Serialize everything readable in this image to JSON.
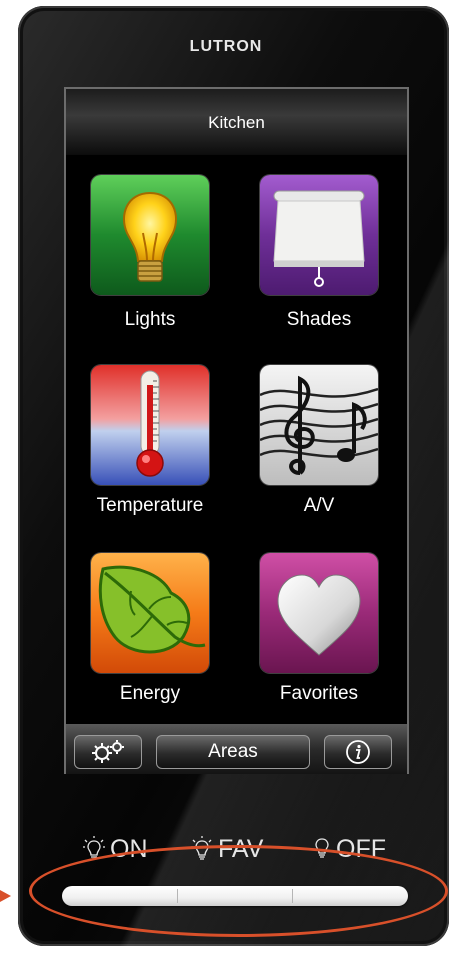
{
  "device": {
    "brand": "LUTRON"
  },
  "screen": {
    "title": "Kitchen",
    "tiles": [
      {
        "label": "Lights",
        "icon": "light-bulb-icon"
      },
      {
        "label": "Shades",
        "icon": "window-shade-icon"
      },
      {
        "label": "Temperature",
        "icon": "thermometer-icon"
      },
      {
        "label": "A/V",
        "icon": "music-notes-icon"
      },
      {
        "label": "Energy",
        "icon": "leaf-icon"
      },
      {
        "label": "Favorites",
        "icon": "heart-icon"
      }
    ],
    "bottom_bar": {
      "settings_icon": "gears-icon",
      "areas_label": "Areas",
      "info_icon": "info-icon"
    }
  },
  "keypad": {
    "on_label": "ON",
    "fav_label": "FAV",
    "off_label": "OFF"
  },
  "colors": {
    "highlight": "#d8502a",
    "lights_tile": "#2e9a3e",
    "shades_tile": "#7a3aa0",
    "energy_tile": "#f07a1a",
    "favorites_tile": "#a0307a"
  }
}
